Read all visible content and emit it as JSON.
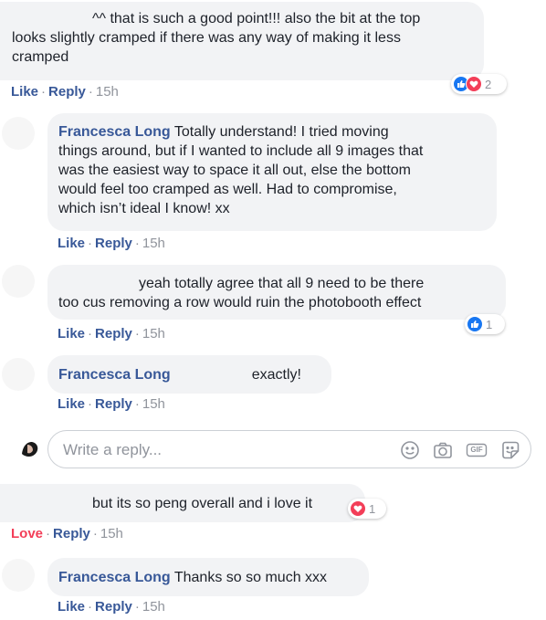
{
  "comments": [
    {
      "text": "^^ that is such a good point!!! also the bit at the top looks slightly cramped if there was any way of making it less cramped",
      "line1": "^^ that is such a good point!!! also the bit at the top",
      "line2": "looks slightly cramped if there was any way of making it less",
      "line3": "cramped",
      "reaction_count": "2",
      "actions": {
        "like": "Like",
        "reply": "Reply",
        "time": "15h"
      }
    },
    {
      "author": "Francesca Long",
      "line1": "Totally understand! I tried moving",
      "line2": "things around, but if I wanted to include all 9 images that",
      "line3": "was the easiest way to space it all out, else the bottom",
      "line4": "would feel too cramped as well. Had to compromise,",
      "line5": "which isn’t ideal I know! xx",
      "actions": {
        "like": "Like",
        "reply": "Reply",
        "time": "15h"
      }
    },
    {
      "line1": "yeah totally agree that all 9 need to be there",
      "line2": "too cus removing a row would ruin the photobooth effect",
      "reaction_count": "1",
      "actions": {
        "like": "Like",
        "reply": "Reply",
        "time": "15h"
      }
    },
    {
      "author": "Francesca Long",
      "text": "exactly!",
      "actions": {
        "like": "Like",
        "reply": "Reply",
        "time": "15h"
      }
    },
    {
      "text": "but its so peng overall and i love it",
      "reaction_count": "1",
      "actions": {
        "like": "Love",
        "reply": "Reply",
        "time": "15h"
      }
    },
    {
      "author": "Francesca Long",
      "text": "Thanks so so much xxx",
      "actions": {
        "like": "Like",
        "reply": "Reply",
        "time": "15h"
      }
    }
  ],
  "reply_box": {
    "placeholder": "Write a reply...",
    "icons": [
      "emoji-icon",
      "camera-icon",
      "gif-icon",
      "sticker-icon"
    ],
    "gif_label": "GIF"
  },
  "colors": {
    "link": "#385898",
    "love": "#f33e58",
    "like_blue": "#1877f2",
    "bubble_bg": "#f2f3f5",
    "meta_gray": "#90949c"
  }
}
